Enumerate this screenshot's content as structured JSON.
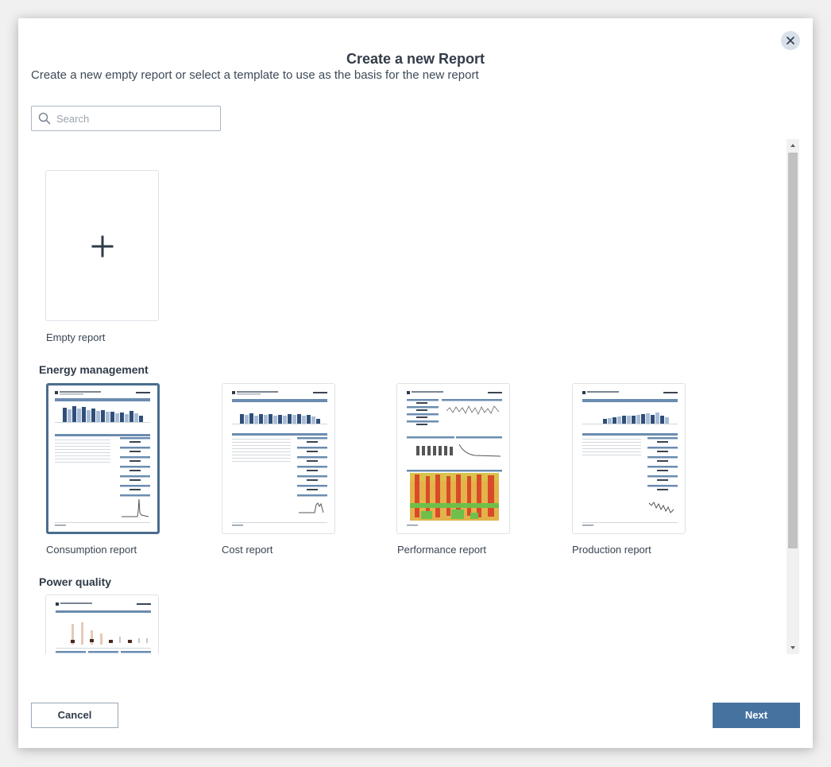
{
  "dialog": {
    "title": "Create a new Report",
    "subtitle": "Create a new empty report or select a template to use as the basis for the new report",
    "close_icon": "close-icon"
  },
  "search": {
    "placeholder": "Search",
    "value": "",
    "icon": "search-icon"
  },
  "empty_report": {
    "label": "Empty report",
    "icon": "plus-icon"
  },
  "sections": [
    {
      "heading": "Energy management",
      "templates": [
        {
          "label": "Consumption report",
          "selected": true
        },
        {
          "label": "Cost report",
          "selected": false
        },
        {
          "label": "Performance report",
          "selected": false
        },
        {
          "label": "Production report",
          "selected": false
        }
      ]
    },
    {
      "heading": "Power quality",
      "templates": [
        {
          "label": "",
          "selected": false
        }
      ]
    }
  ],
  "footer": {
    "cancel_label": "Cancel",
    "next_label": "Next"
  },
  "colors": {
    "accent": "#4672a0",
    "selected_border": "#4a6d8f",
    "thumb_header": "#6b8cb0"
  }
}
